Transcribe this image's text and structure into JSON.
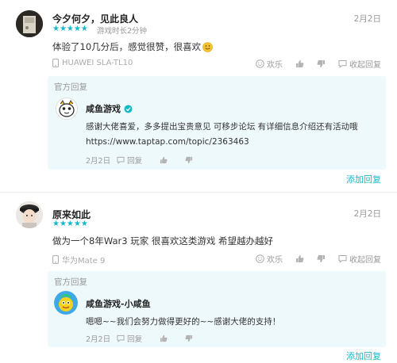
{
  "reviews": [
    {
      "username": "今夕何夕，见此良人",
      "rating": 5,
      "stars": "★★★★★",
      "playtime": "游戏时长2分钟",
      "date": "2月2日",
      "text": "体验了10几分后，感觉很赞，很喜欢",
      "emoji_icon": "smile-icon",
      "device": "HUAWEI SLA-TL10",
      "actions": {
        "fun_label": "欢乐",
        "collapse_label": "收起回复"
      },
      "official_reply": {
        "label": "官方回复",
        "developer_name": "咸鱼游戏",
        "lines": [
          "感谢大佬喜爱，多多提出宝贵意见 可移步论坛 有详细信息介绍还有活动哦",
          "https://www.taptap.com/topic/2363463"
        ],
        "date": "2月2日",
        "reply_label": "回复"
      },
      "add_reply_label": "添加回复"
    },
    {
      "username": "原来如此",
      "rating": 5,
      "stars": "★★★★★",
      "date": "2月2日",
      "text": "做为一个8年War3 玩家 很喜欢这类游戏 希望越办越好",
      "device": "华为Mate 9",
      "actions": {
        "fun_label": "欢乐",
        "collapse_label": "收起回复"
      },
      "official_reply": {
        "label": "官方回复",
        "developer_name": "咸鱼游戏-小咸鱼",
        "lines": [
          "嗯嗯~~我们会努力做得更好的~~感谢大佬的支持！"
        ],
        "date": "2月2日",
        "reply_label": "回复"
      },
      "add_reply_label": "添加回复"
    }
  ],
  "colors": {
    "accent": "#14b9c8",
    "reply_bg": "#eef9fb",
    "verified": "#14b9c8"
  }
}
